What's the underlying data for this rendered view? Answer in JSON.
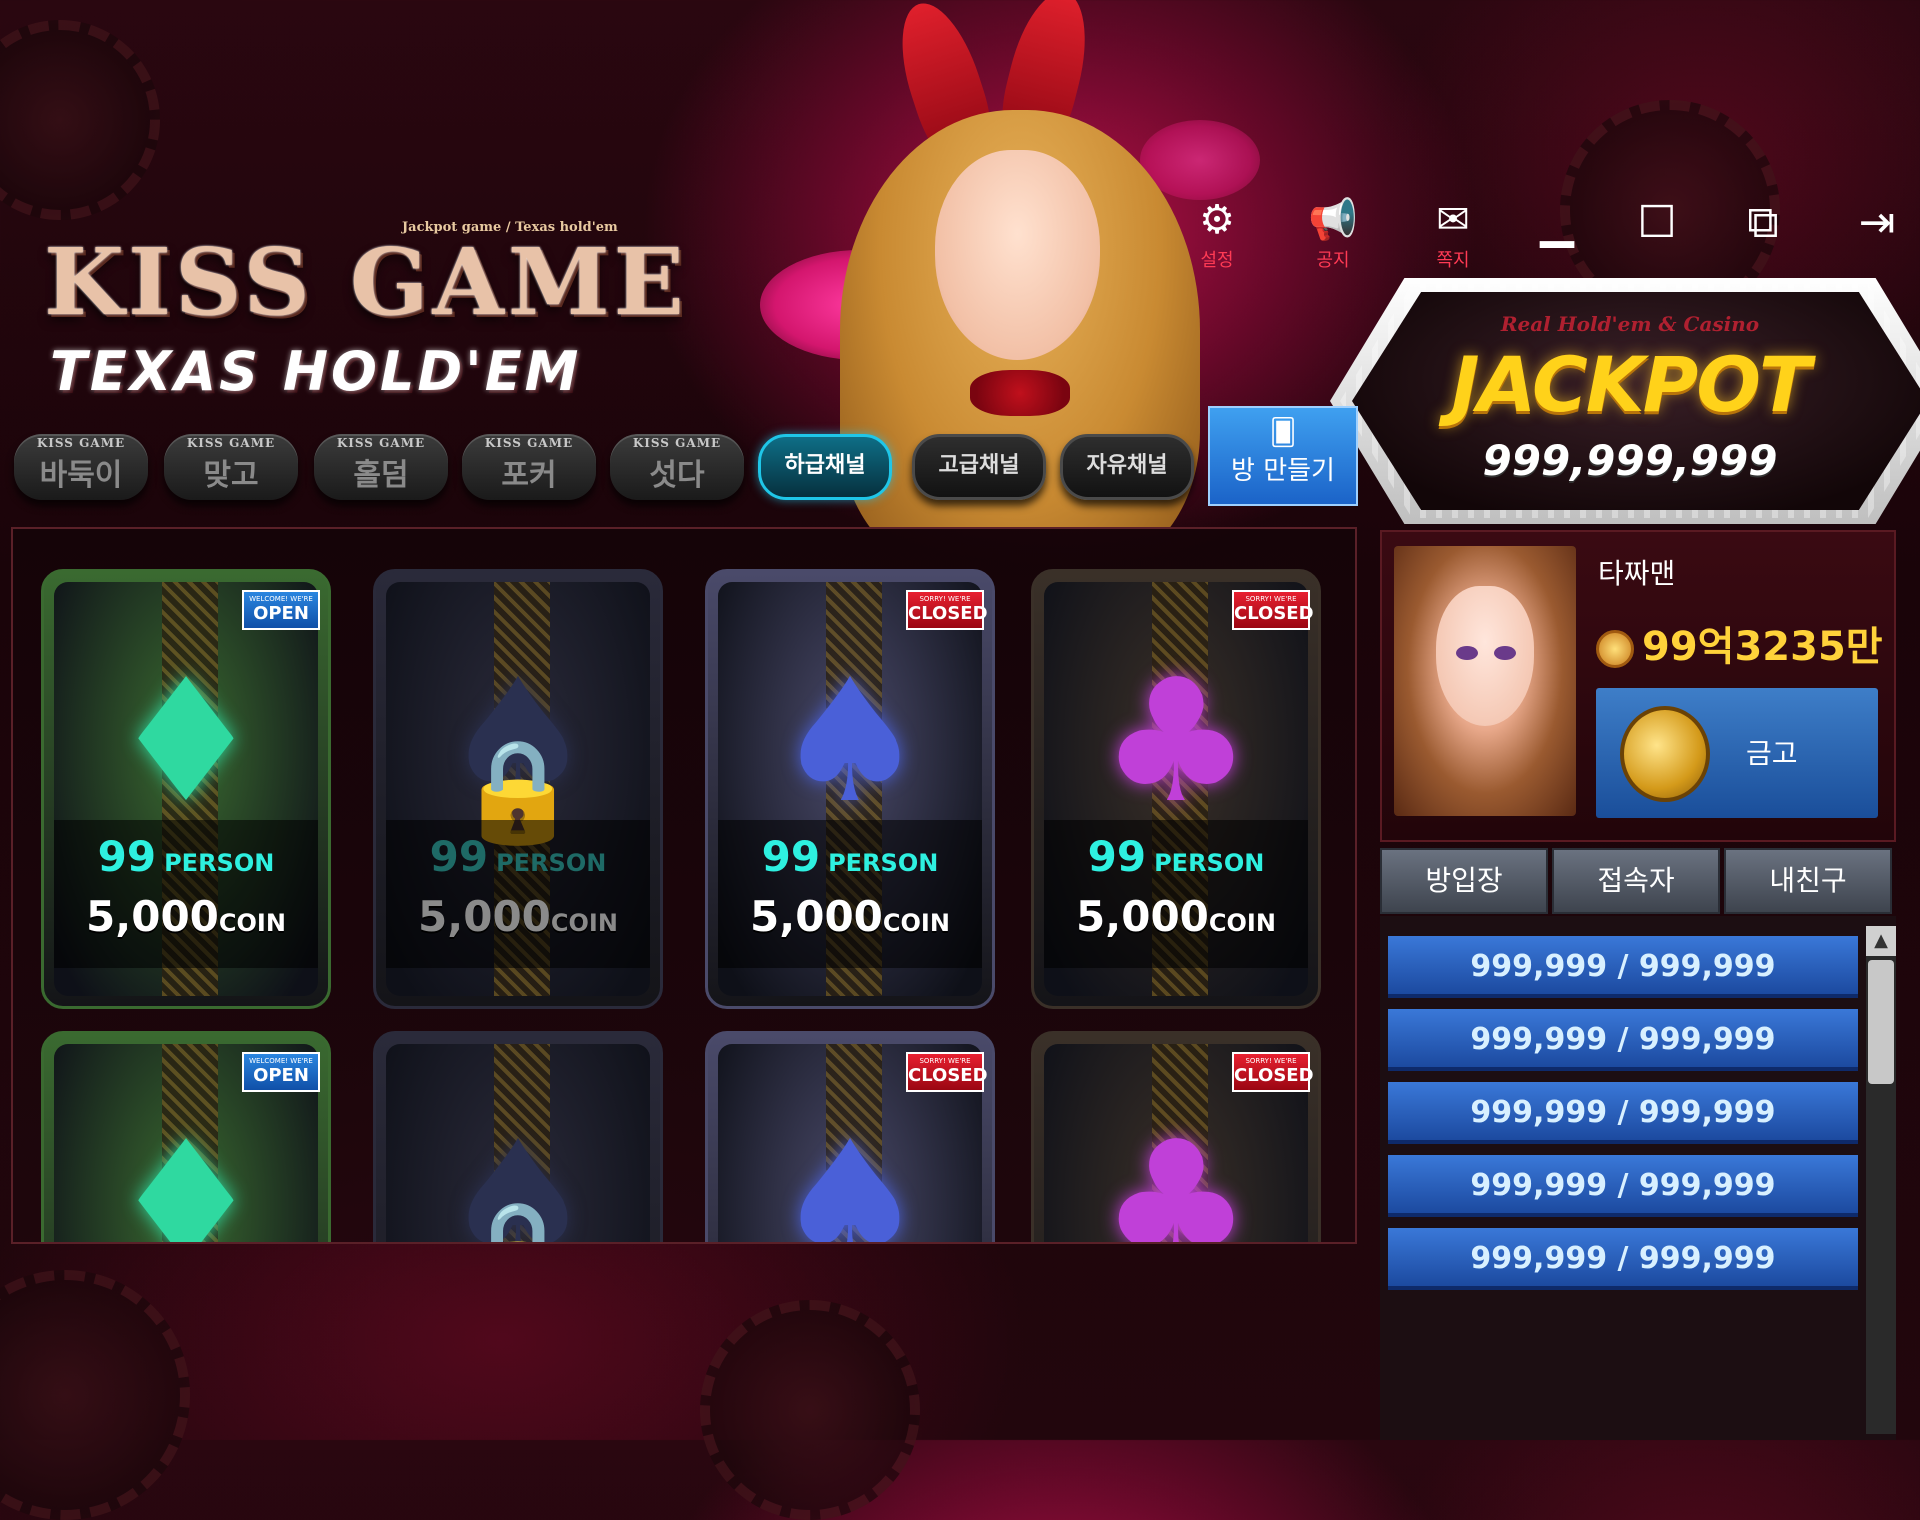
{
  "logo": {
    "subtitle": "Jackpot game / Texas hold'em",
    "title": "KISS GAME",
    "game": "TEXAS HOLD'EM"
  },
  "top_buttons": [
    {
      "label": "설정",
      "icon": "gear-icon"
    },
    {
      "label": "공지",
      "icon": "megaphone-icon"
    },
    {
      "label": "쪽지",
      "icon": "note-icon"
    }
  ],
  "window_buttons": [
    {
      "icon": "minimize-icon",
      "glyph": "▁"
    },
    {
      "icon": "maximize-icon",
      "glyph": "☐"
    },
    {
      "icon": "popout-icon",
      "glyph": "⧉"
    },
    {
      "icon": "exit-icon",
      "glyph": "⇥"
    }
  ],
  "jackpot": {
    "script": "Real Hold'em & Casino",
    "title": "JACKPOT",
    "value": "999,999,999"
  },
  "game_tabs": [
    {
      "small": "KISS GAME",
      "label": "바둑이"
    },
    {
      "small": "KISS GAME",
      "label": "맞고"
    },
    {
      "small": "KISS GAME",
      "label": "홀덤"
    },
    {
      "small": "KISS GAME",
      "label": "포커"
    },
    {
      "small": "KISS GAME",
      "label": "섯다"
    }
  ],
  "channel_tabs": [
    {
      "label": "하급채널",
      "active": true
    },
    {
      "label": "고급채널",
      "active": false
    },
    {
      "label": "자유채널",
      "active": false
    }
  ],
  "make_room": {
    "label": "방 만들기"
  },
  "rooms": [
    {
      "status": "OPEN",
      "status_small": "WELCOME! WE'RE",
      "suit": "♦",
      "suit_color": "#2fd9a0",
      "person": "99",
      "person_word": "PERSON",
      "coin": "5,000",
      "coin_word": "COIN",
      "locked": false,
      "frame": "#3a6a30"
    },
    {
      "status": "",
      "status_small": "",
      "suit": "♠",
      "suit_color": "#2a3050",
      "person": "99",
      "person_word": "PERSON",
      "coin": "5,000",
      "coin_word": "COIN",
      "locked": true,
      "frame": "#2a2a3a"
    },
    {
      "status": "CLOSED",
      "status_small": "SORRY! WE'RE",
      "suit": "♠",
      "suit_color": "#4a60d8",
      "person": "99",
      "person_word": "PERSON",
      "coin": "5,000",
      "coin_word": "COIN",
      "locked": false,
      "frame": "#4a4a6a"
    },
    {
      "status": "CLOSED",
      "status_small": "SORRY! WE'RE",
      "suit": "♣",
      "suit_color": "#c040d8",
      "person": "99",
      "person_word": "PERSON",
      "coin": "5,000",
      "coin_word": "COIN",
      "locked": false,
      "frame": "#3a3028"
    },
    {
      "status": "OPEN",
      "status_small": "WELCOME! WE'RE",
      "suit": "♦",
      "suit_color": "#2fd9a0",
      "locked": false,
      "frame": "#3a6a30"
    },
    {
      "status": "",
      "status_small": "",
      "suit": "♠",
      "suit_color": "#2a3050",
      "locked": true,
      "frame": "#2a2a3a"
    },
    {
      "status": "CLOSED",
      "status_small": "SORRY! WE'RE",
      "suit": "♠",
      "suit_color": "#4a60d8",
      "locked": false,
      "frame": "#4a4a6a"
    },
    {
      "status": "CLOSED",
      "status_small": "SORRY! WE'RE",
      "suit": "♣",
      "suit_color": "#c040d8",
      "locked": false,
      "frame": "#3a3028"
    }
  ],
  "profile": {
    "name": "타짜맨",
    "money": "99억3235만",
    "safe_label": "금고"
  },
  "side_tabs": [
    "방입장",
    "접속자",
    "내친구"
  ],
  "list_rows": [
    "999,999 / 999,999",
    "999,999 / 999,999",
    "999,999 / 999,999",
    "999,999 / 999,999",
    "999,999 / 999,999"
  ]
}
